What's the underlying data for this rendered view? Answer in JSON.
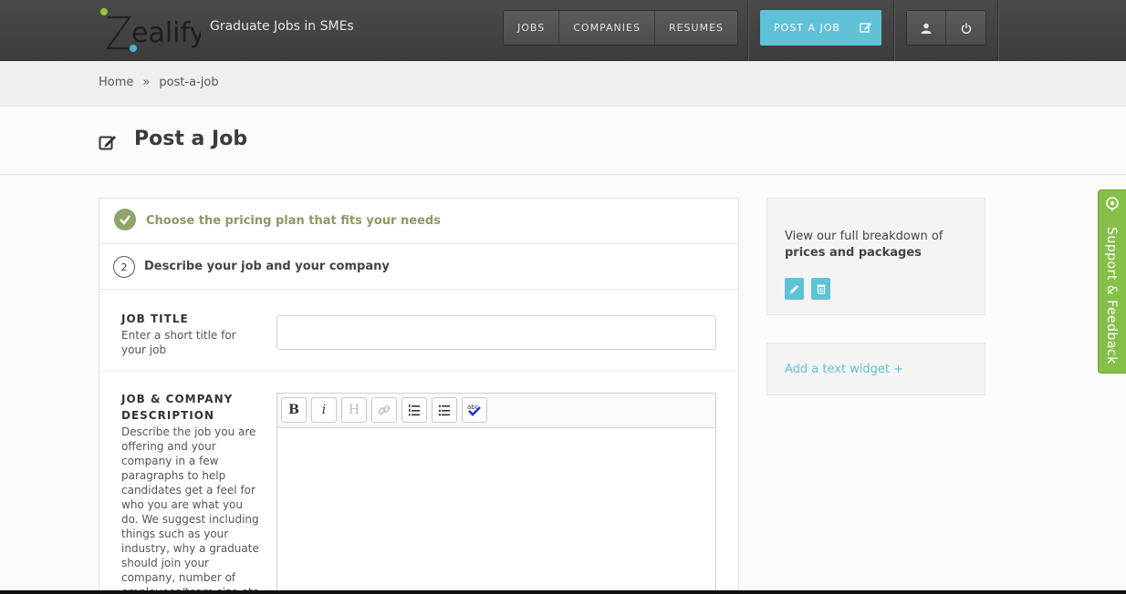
{
  "header": {
    "logo_text": "Zealify",
    "tagline": "Graduate Jobs in SMEs",
    "nav": [
      {
        "label": "JOBS"
      },
      {
        "label": "COMPANIES"
      },
      {
        "label": "RESUMES"
      }
    ],
    "post_job_label": "POST A JOB",
    "icons": [
      "user-icon",
      "power-icon"
    ]
  },
  "breadcrumb": {
    "home": "Home",
    "separator": "»",
    "current": "post-a-job"
  },
  "page": {
    "title": "Post a Job"
  },
  "steps": {
    "step1_label": "Choose the pricing plan that fits your needs",
    "step2_number": "2",
    "step2_label": "Describe your job and your company"
  },
  "form": {
    "job_title_label": "JOB TITLE",
    "job_title_help": "Enter a short title for your job",
    "job_title_value": "",
    "desc_label_line1": "JOB & COMPANY",
    "desc_label_line2": "DESCRIPTION",
    "desc_help": "Describe the job you are offering and your company in a few paragraphs to help candidates get a feel for who you are what you do. We suggest including things such as your industry, why a graduate should join your company, number of employees/team size etc.",
    "toolbar": {
      "bold": "B",
      "italic": "i",
      "heading": "H"
    }
  },
  "sidebar": {
    "pricing_text": "View our full breakdown of",
    "pricing_bold": "prices and packages",
    "add_widget": "Add a text widget +"
  },
  "support_tab": {
    "label": "Support & Feedback"
  },
  "colors": {
    "accent": "#5fc2d6",
    "success": "#8fa46a",
    "support": "#86c04a",
    "header": "#444444"
  }
}
